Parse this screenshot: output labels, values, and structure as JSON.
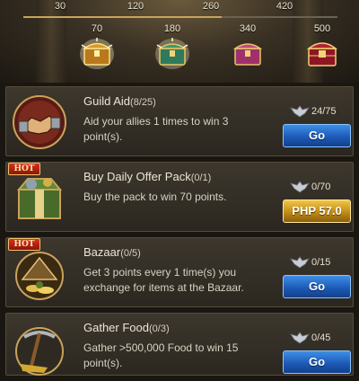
{
  "rewards": {
    "thresholds": [
      "30",
      "120",
      "260",
      "420"
    ],
    "progress_fraction": 0.63,
    "chests": [
      {
        "value": "70",
        "icon": "gold-chest-icon"
      },
      {
        "value": "180",
        "icon": "green-chest-icon"
      },
      {
        "value": "340",
        "icon": "pink-chest-icon"
      },
      {
        "value": "500",
        "icon": "red-chest-icon"
      }
    ]
  },
  "tasks": [
    {
      "title": "Guild Aid",
      "count": "(8/25)",
      "description": "Aid your allies 1 times to win 3 point(s).",
      "points": "24/75",
      "button": "Go",
      "button_type": "go",
      "hot": false,
      "icon": "handshake-icon"
    },
    {
      "title": "Buy Daily Offer Pack",
      "count": "(0/1)",
      "description": "Buy the pack to win 70 points.",
      "points": "0/70",
      "button": "PHP 57.0",
      "button_type": "price",
      "hot": true,
      "hot_label": "HOT",
      "icon": "gift-crate-icon"
    },
    {
      "title": "Bazaar",
      "count": "(0/5)",
      "description": "Get 3 points every 1 time(s) you exchange for items at the Bazaar.",
      "points": "0/15",
      "button": "Go",
      "button_type": "go",
      "hot": true,
      "hot_label": "HOT",
      "icon": "bazaar-tent-icon"
    },
    {
      "title": "Gather Food",
      "count": "(0/3)",
      "description": "Gather >500,000 Food to win 15 point(s).",
      "points": "0/45",
      "button": "Go",
      "button_type": "go",
      "hot": false,
      "icon": "pickaxe-icon"
    }
  ],
  "colors": {
    "go_button": "#1d5bb8",
    "price_button": "#c28c16",
    "hot_badge": "#d8321f"
  }
}
